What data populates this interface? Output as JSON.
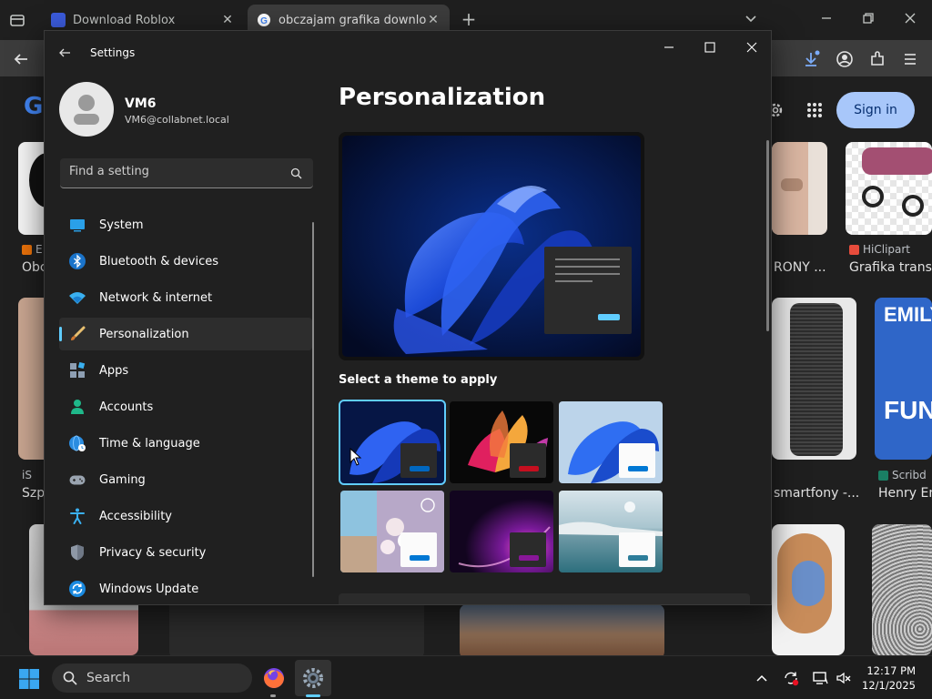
{
  "browser": {
    "tabs": [
      {
        "label": "Download Roblox",
        "active": false
      },
      {
        "label": "obczajam grafika download - G",
        "active": true
      }
    ],
    "new_tab": "+"
  },
  "google_page": {
    "logo_fragment": "G",
    "sign_in": "Sign in",
    "results": {
      "r1_source": "E",
      "r1_title": "Obc",
      "r2_title": "RONY ...",
      "r3_source": "HiClipart",
      "r3_title": "Grafika transp",
      "r4_source": "iS",
      "r4_title": "Szp",
      "r5_title": "smartfony -...",
      "r6_source": "Scribd",
      "r6_title": "Henry En",
      "emily": "EMILY",
      "fun": "FUN"
    }
  },
  "settings": {
    "window_title": "Settings",
    "profile": {
      "name": "VM6",
      "email": "VM6@collabnet.local"
    },
    "search_placeholder": "Find a setting",
    "nav": [
      {
        "label": "System",
        "icon": "system-icon"
      },
      {
        "label": "Bluetooth & devices",
        "icon": "bluetooth-icon"
      },
      {
        "label": "Network & internet",
        "icon": "wifi-icon"
      },
      {
        "label": "Personalization",
        "icon": "brush-icon",
        "active": true
      },
      {
        "label": "Apps",
        "icon": "apps-icon"
      },
      {
        "label": "Accounts",
        "icon": "person-icon"
      },
      {
        "label": "Time & language",
        "icon": "globe-clock-icon"
      },
      {
        "label": "Gaming",
        "icon": "gamepad-icon"
      },
      {
        "label": "Accessibility",
        "icon": "accessibility-icon"
      },
      {
        "label": "Privacy & security",
        "icon": "shield-icon"
      },
      {
        "label": "Windows Update",
        "icon": "update-icon"
      }
    ],
    "page_title": "Personalization",
    "theme_heading": "Select a theme to apply",
    "themes": [
      {
        "name": "windows-light-bloom-dark",
        "accent": "#0067c0",
        "selected": true
      },
      {
        "name": "glow",
        "accent": "#c50f1f"
      },
      {
        "name": "windows-light",
        "accent": "#0078d4"
      },
      {
        "name": "spotlight",
        "accent": "#0078d4"
      },
      {
        "name": "captured-motion",
        "accent": "#881798"
      },
      {
        "name": "flow",
        "accent": "#2d7d9a"
      }
    ]
  },
  "taskbar": {
    "search_label": "Search",
    "time": "12:17 PM",
    "date": "12/1/2025"
  },
  "colors": {
    "accent": "#60cdff",
    "window_bg": "#202020",
    "signin_bg": "#a8c7fa"
  }
}
